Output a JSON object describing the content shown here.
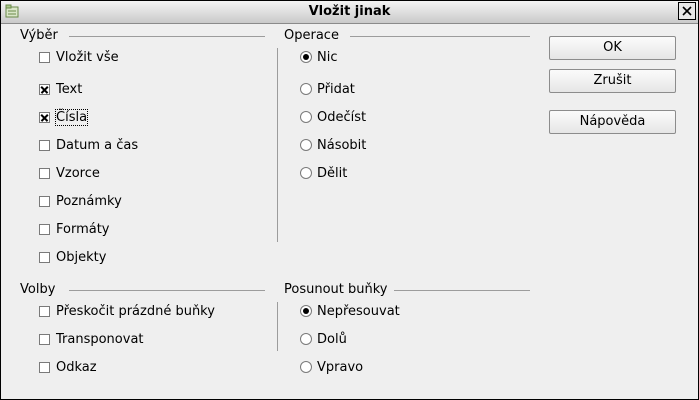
{
  "window": {
    "title": "Vložit jinak"
  },
  "selection": {
    "label": "Výběr",
    "items": [
      {
        "label": "Vložit vše",
        "checked": false
      },
      {
        "label": "Text",
        "checked": true
      },
      {
        "label": "Čísla",
        "checked": true
      },
      {
        "label": "Datum a čas",
        "checked": false
      },
      {
        "label": "Vzorce",
        "checked": false
      },
      {
        "label": "Poznámky",
        "checked": false
      },
      {
        "label": "Formáty",
        "checked": false
      },
      {
        "label": "Objekty",
        "checked": false
      }
    ]
  },
  "operation": {
    "label": "Operace",
    "items": [
      {
        "label": "Nic",
        "selected": true
      },
      {
        "label": "Přidat",
        "selected": false
      },
      {
        "label": "Odečíst",
        "selected": false
      },
      {
        "label": "Násobit",
        "selected": false
      },
      {
        "label": "Dělit",
        "selected": false
      }
    ]
  },
  "options": {
    "label": "Volby",
    "items": [
      {
        "label": "Přeskočit prázdné buňky",
        "checked": false
      },
      {
        "label": "Transponovat",
        "checked": false
      },
      {
        "label": "Odkaz",
        "checked": false
      }
    ]
  },
  "shift_cells": {
    "label": "Posunout buňky",
    "items": [
      {
        "label": "Nepřesouvat",
        "selected": true
      },
      {
        "label": "Dolů",
        "selected": false
      },
      {
        "label": "Vpravo",
        "selected": false
      }
    ]
  },
  "buttons": {
    "ok": "OK",
    "cancel": "Zrušit",
    "help": "Nápověda"
  }
}
